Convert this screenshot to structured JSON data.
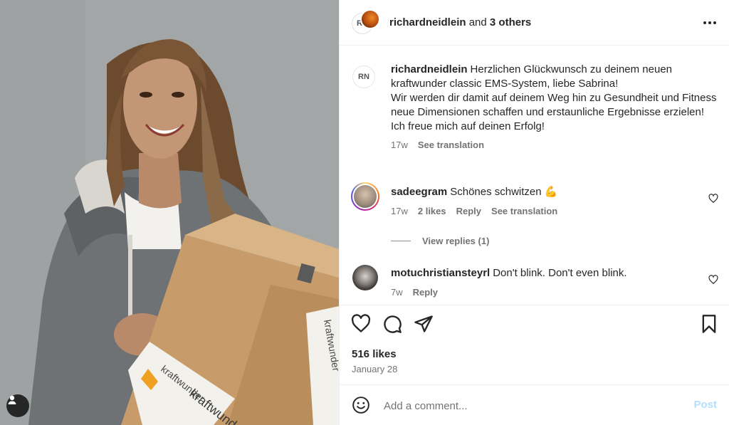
{
  "header": {
    "username": "richardneidlein",
    "and_text": "and",
    "others": "3 others",
    "more_icon": "more-horizontal-icon",
    "logo_text": "RN"
  },
  "caption": {
    "username": "richardneidlein",
    "lines": [
      "Herzlichen Glückwunsch zu deinem neuen kraftwunder classic EMS-System, liebe Sabrina!",
      "Wir werden dir damit auf deinem Weg hin zu Gesundheit und Fitness neue Dimensionen schaffen und erstaunliche Ergebnisse erzielen!",
      "Ich freue mich auf deinen Erfolg!"
    ],
    "time": "17w",
    "translate": "See translation"
  },
  "comments": [
    {
      "username": "sadeegram",
      "text": "Schönes schwitzen",
      "emoji": "💪",
      "time": "17w",
      "likes": "2 likes",
      "reply": "Reply",
      "translate": "See translation",
      "view_replies": "View replies (1)"
    },
    {
      "username": "motuchristiansteyrl",
      "text": "Don't blink. Don't even blink.",
      "time": "7w",
      "reply": "Reply"
    }
  ],
  "actions": {
    "likes": "516 likes",
    "date": "January 28"
  },
  "add_comment": {
    "placeholder": "Add a comment...",
    "post": "Post"
  },
  "photo": {
    "box_text_1": "kraftwunder",
    "box_text_2": "kraftwunder",
    "box_text_3": "kraftwunder"
  },
  "colors": {
    "text": "#262626",
    "secondary": "#737373",
    "post_disabled": "#b2dffc",
    "border": "#efefef"
  }
}
